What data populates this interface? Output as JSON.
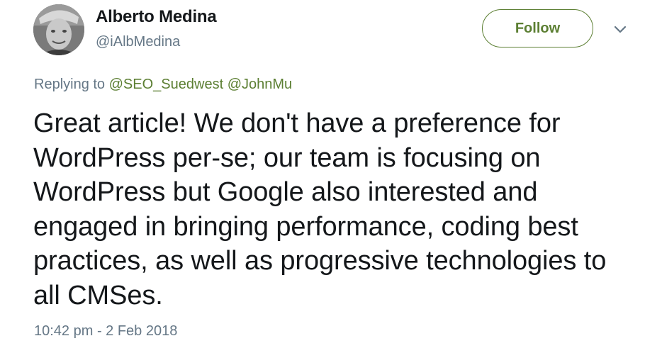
{
  "author": {
    "name": "Alberto Medina",
    "handle": "@iAlbMedina"
  },
  "follow_button": {
    "label": "Follow"
  },
  "more_menu": {
    "icon": "chevron-down-icon"
  },
  "replying": {
    "prefix": "Replying to",
    "mentions": [
      "@SEO_Suedwest",
      "@JohnMu"
    ]
  },
  "tweet": {
    "text": "Great article! We don't have a preference for WordPress per-se; our team is focusing on WordPress but Google also interested and engaged in bringing performance, coding best practices, as well as progressive technologies to all CMSes.",
    "timestamp": "10:42 pm - 2 Feb 2018"
  },
  "colors": {
    "accent": "#5c7f33",
    "text": "#14171a",
    "muted": "#657786"
  }
}
